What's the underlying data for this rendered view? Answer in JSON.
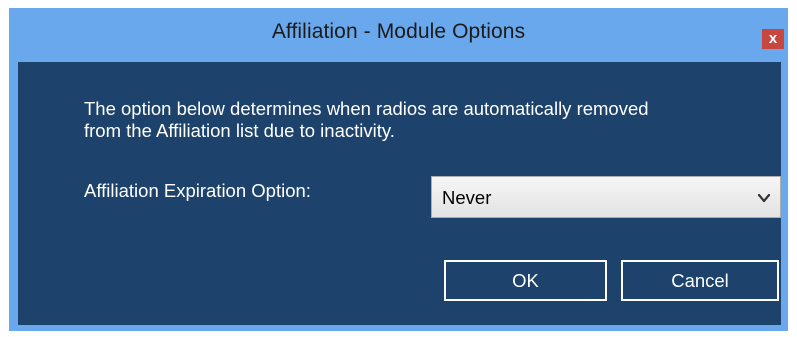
{
  "window": {
    "title": "Affiliation - Module Options",
    "close_glyph": "x"
  },
  "dialog": {
    "description_line1": "The option below determines when radios are automatically removed",
    "description_line2": "from the Affiliation list due to inactivity.",
    "expiration_label": "Affiliation Expiration Option:",
    "expiration_select": {
      "selected": "Never"
    },
    "buttons": {
      "ok": "OK",
      "cancel": "Cancel"
    }
  },
  "colors": {
    "titlebar": "#69a8ec",
    "client_background": "#1d426b",
    "close_button": "#c7463d",
    "text": "#ffffff"
  },
  "icons": {
    "close": "close-icon",
    "dropdown": "chevron-down-icon"
  }
}
